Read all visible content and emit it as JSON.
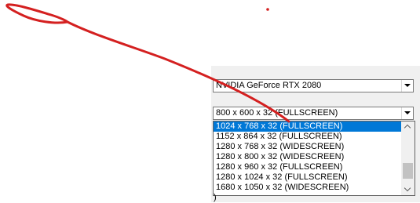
{
  "graphics_adapter": {
    "selected": "NVIDIA GeForce RTX 2080"
  },
  "resolution": {
    "selected": "800 x 600 x 32 (FULLSCREEN)",
    "options": [
      {
        "label": "1024 x 768 x 32 (FULLSCREEN)",
        "highlighted": true
      },
      {
        "label": "1152 x 864 x 32 (FULLSCREEN)",
        "highlighted": false
      },
      {
        "label": "1280 x 768 x 32 (WIDESCREEN)",
        "highlighted": false
      },
      {
        "label": "1280 x 800 x 32 (WIDESCREEN)",
        "highlighted": false
      },
      {
        "label": "1280 x 960 x 32 (FULLSCREEN)",
        "highlighted": false
      },
      {
        "label": "1280 x 1024 x 32 (FULLSCREEN)",
        "highlighted": false
      },
      {
        "label": "1680 x 1050 x 32 (WIDESCREEN)",
        "highlighted": false
      }
    ],
    "scroll_position": 0.85
  },
  "partial_text": ")",
  "colors": {
    "highlight": "#0078d7",
    "annotation": "#d42020",
    "panel": "#f0f0f0"
  }
}
